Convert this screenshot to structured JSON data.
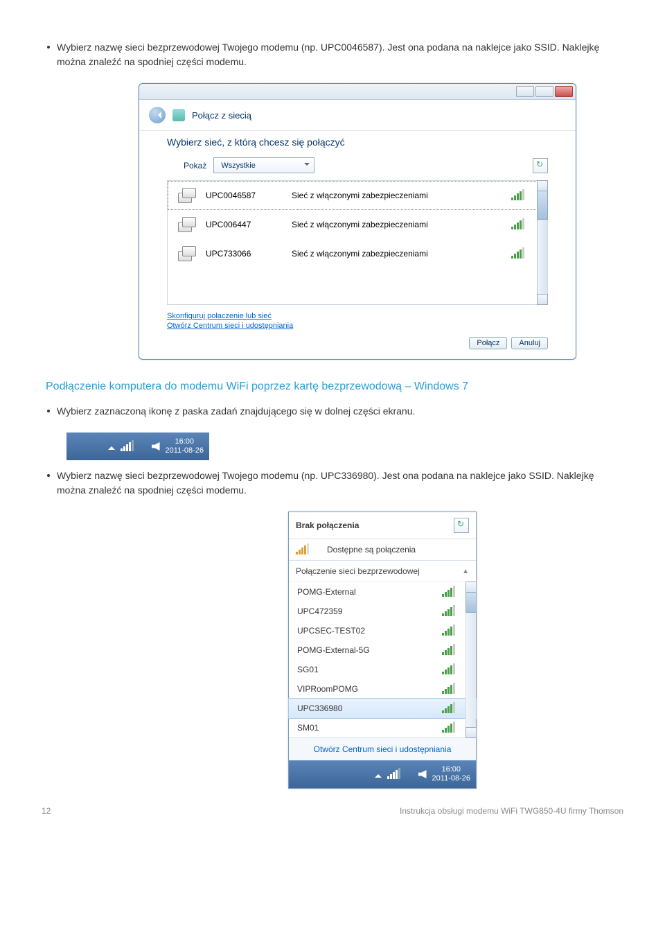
{
  "para1": "Wybierz nazwę sieci bezprzewodowej Twojego modemu (np. UPC0046587). Jest ona podana na naklejce jako SSID. Naklejkę można znaleźć na spodniej części modemu.",
  "vista": {
    "title": "Połącz z siecią",
    "prompt": "Wybierz sieć, z którą chcesz się połączyć",
    "pokaz_label": "Pokaż",
    "pokaz_value": "Wszystkie",
    "networks": [
      {
        "ssid": "UPC0046587",
        "desc": "Sieć z włączonymi zabezpieczeniami"
      },
      {
        "ssid": "UPC006447",
        "desc": "Sieć z włączonymi zabezpieczeniami"
      },
      {
        "ssid": "UPC733066",
        "desc": "Sieć z włączonymi zabezpieczeniami"
      }
    ],
    "link1": "Skonfiguruj połaczenie lub sieć",
    "link2": "Otwórz Centrum sieci i udostępniania",
    "btn_connect": "Połącz",
    "btn_cancel": "Anuluj"
  },
  "heading": "Podłączenie komputera do modemu WiFi poprzez kartę bezprzewodową – Windows 7",
  "para2": "Wybierz zaznaczoną ikonę z paska zadań znajdującego się w dolnej części ekranu.",
  "tray": {
    "time": "16:00",
    "date": "2011-08-26"
  },
  "para3": "Wybierz nazwę sieci bezprzewodowej Twojego modemu (np. UPC336980). Jest ona podana na naklejce jako SSID. Naklejkę można znaleźć na spodniej części modemu.",
  "flyout": {
    "noconn": "Brak połączenia",
    "avail": "Dostępne są połączenia",
    "section": "Połączenie sieci bezprzewodowej",
    "nets": [
      "POMG-External",
      "UPC472359",
      "UPCSEC-TEST02",
      "POMG-External-5G",
      "SG01",
      "VIPRoomPOMG",
      "UPC336980",
      "SM01"
    ],
    "footer": "Otwórz Centrum sieci i udostępniania",
    "time": "16:00",
    "date": "2011-08-26"
  },
  "page_no": "12",
  "doc_footer": "Instrukcja obsługi modemu WiFi TWG850-4U firmy Thomson"
}
